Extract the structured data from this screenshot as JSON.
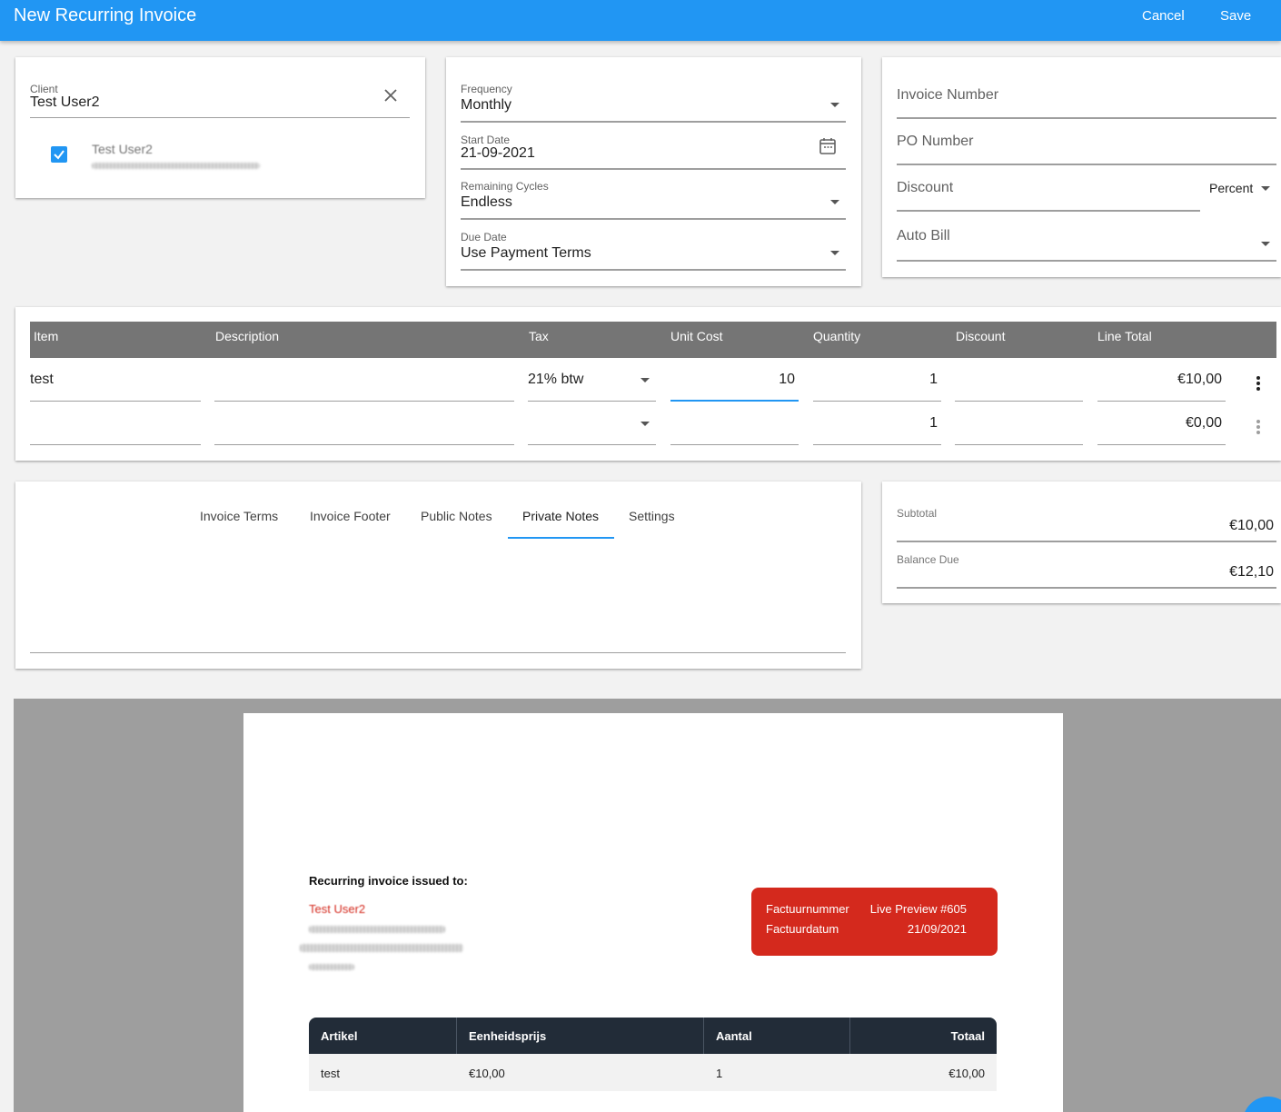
{
  "header": {
    "title": "New Recurring Invoice",
    "cancel_label": "Cancel",
    "save_label": "Save"
  },
  "client": {
    "label": "Client",
    "value": "Test User2",
    "contact_name": "Test User2"
  },
  "schedule": {
    "frequency_label": "Frequency",
    "frequency_value": "Monthly",
    "start_date_label": "Start Date",
    "start_date_value": "21-09-2021",
    "remaining_cycles_label": "Remaining Cycles",
    "remaining_cycles_value": "Endless",
    "due_date_label": "Due Date",
    "due_date_value": "Use Payment Terms"
  },
  "details": {
    "invoice_number_placeholder": "Invoice Number",
    "po_number_placeholder": "PO Number",
    "discount_placeholder": "Discount",
    "discount_type": "Percent",
    "auto_bill_placeholder": "Auto Bill"
  },
  "line_items": {
    "columns": [
      "Item",
      "Description",
      "Tax",
      "Unit Cost",
      "Quantity",
      "Discount",
      "Line Total"
    ],
    "rows": [
      {
        "item": "test",
        "description": "",
        "tax": "21% btw",
        "unit_cost": "10",
        "quantity": "1",
        "discount": "",
        "line_total": "€10,00"
      },
      {
        "item": "",
        "description": "",
        "tax": "",
        "unit_cost": "",
        "quantity": "1",
        "discount": "",
        "line_total": "€0,00"
      }
    ]
  },
  "tabs": [
    {
      "label": "Invoice Terms"
    },
    {
      "label": "Invoice Footer"
    },
    {
      "label": "Public Notes"
    },
    {
      "label": "Private Notes",
      "active": true
    },
    {
      "label": "Settings"
    }
  ],
  "totals": {
    "subtotal_label": "Subtotal",
    "subtotal_value": "€10,00",
    "balance_label": "Balance Due",
    "balance_value": "€12,10"
  },
  "preview": {
    "issued_to_label": "Recurring invoice issued to:",
    "client_name": "Test User2",
    "invoice_number_label": "Factuurnummer",
    "invoice_number_value": "Live Preview #605",
    "invoice_date_label": "Factuurdatum",
    "invoice_date_value": "21/09/2021",
    "table_headers": [
      "Artikel",
      "Eenheidsprijs",
      "Aantal",
      "Totaal"
    ],
    "table_rows": [
      {
        "artikel": "test",
        "eenheidsprijs": "€10,00",
        "aantal": "1",
        "totaal": "€10,00"
      }
    ],
    "accent_color": "#d4291d"
  },
  "colors": {
    "primary": "#2196f3",
    "table_header": "#757575",
    "preview_header": "#222c38"
  }
}
